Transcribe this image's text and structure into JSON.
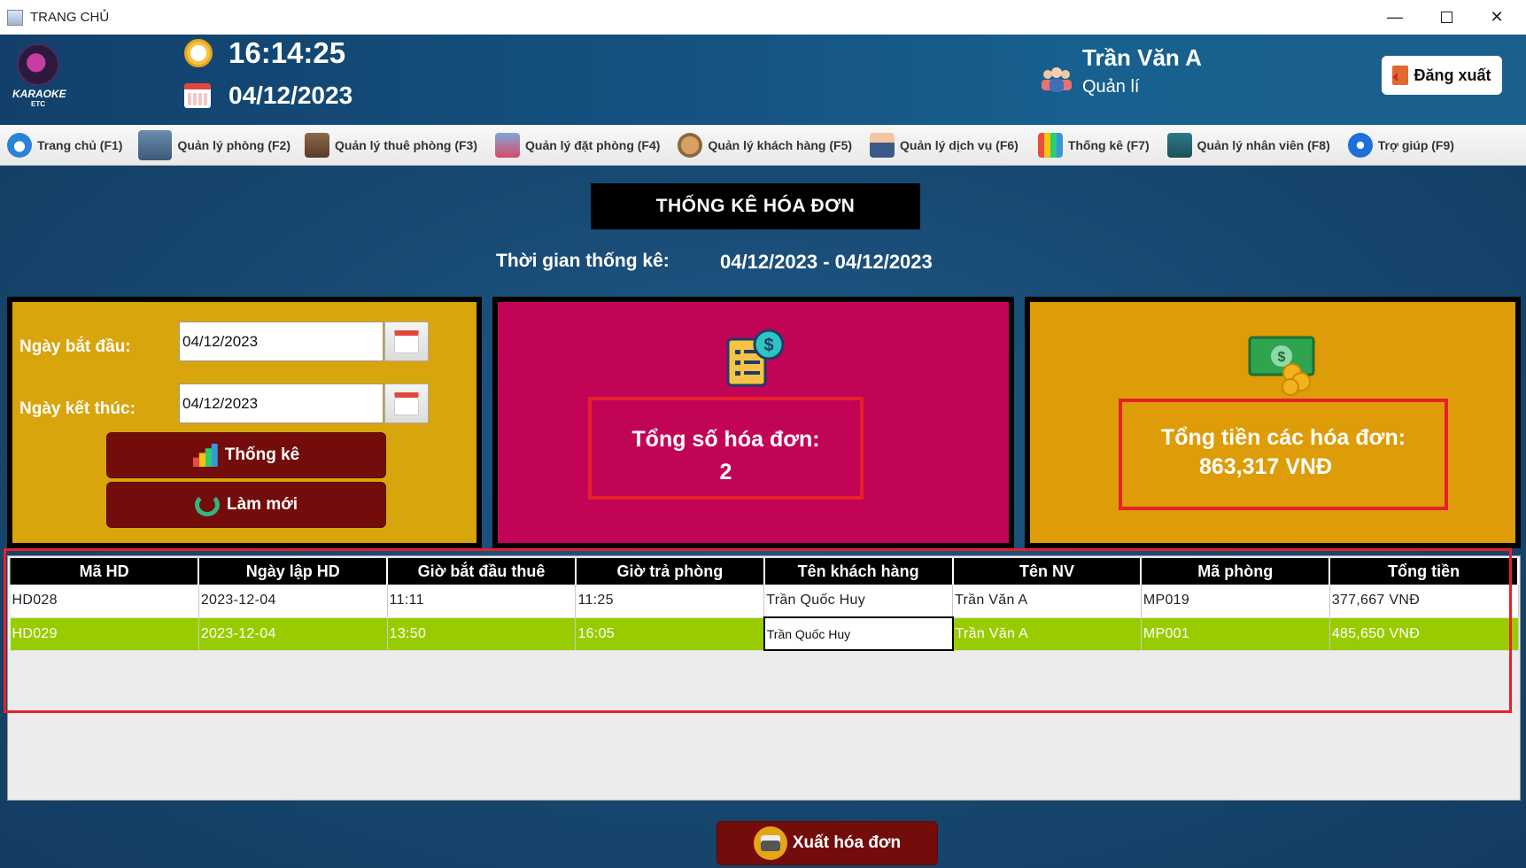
{
  "window": {
    "title": "TRANG CHỦ"
  },
  "header": {
    "logo_text": "KARAOKE",
    "logo_sub": "ETC",
    "time": "16:14:25",
    "date": "04/12/2023",
    "user_name": "Trần Văn A",
    "user_role": "Quản lí",
    "logout_label": "Đăng xuất"
  },
  "menu": [
    {
      "label": "Trang chủ (F1)",
      "icon": "home-icon"
    },
    {
      "label": "Quản lý phòng (F2)",
      "icon": "building-icon"
    },
    {
      "label": "Quản lý thuê phòng (F3)",
      "icon": "hotel-icon"
    },
    {
      "label": "Quản lý đặt phòng (F4)",
      "icon": "phone-booking-icon"
    },
    {
      "label": "Quản lý khách hàng (F5)",
      "icon": "customer-hand-icon"
    },
    {
      "label": "Quản lý dịch vụ (F6)",
      "icon": "staff-service-icon"
    },
    {
      "label": "Thống kê (F7)",
      "icon": "bar-chart-icon"
    },
    {
      "label": "Quản lý nhân viên (F8)",
      "icon": "team-icon"
    },
    {
      "label": "Trợ giúp (F9)",
      "icon": "help-icon"
    }
  ],
  "main": {
    "title": "THỐNG KÊ HÓA ĐƠN",
    "period_label": "Thời gian thống kê:",
    "period_value": "04/12/2023 - 04/12/2023",
    "filter": {
      "start_label": "Ngày bắt đầu:",
      "start_value": "04/12/2023",
      "end_label": "Ngày kết thúc:",
      "end_value": "04/12/2023",
      "stats_button": "Thống kê",
      "refresh_button": "Làm mới"
    },
    "invoice_count": {
      "label": "Tổng số hóa đơn:",
      "value": "2"
    },
    "invoice_total": {
      "label": "Tổng tiền các hóa đơn:",
      "value": "863,317 VNĐ"
    },
    "table": {
      "columns": [
        "Mã HD",
        "Ngày lập HD",
        "Giờ bắt đầu thuê",
        "Giờ trả phòng",
        "Tên khách hàng",
        "Tên NV",
        "Mã phòng",
        "Tổng tiền"
      ],
      "rows": [
        [
          "HD028",
          "2023-12-04",
          "11:11",
          "11:25",
          "Trần Quốc Huy",
          "Trần Văn A",
          "MP019",
          "377,667 VNĐ"
        ],
        [
          "HD029",
          "2023-12-04",
          "13:50",
          "16:05",
          "Trần Quốc Huy",
          "Trần Văn A",
          "MP001",
          "485,650 VNĐ"
        ]
      ]
    },
    "export_button": "Xuất hóa đơn"
  },
  "colors": {
    "header_bg": "#155280",
    "panel_left": "#d8a50c",
    "panel_mid": "#c20456",
    "panel_right": "#de9c08",
    "dark_button": "#740c0c",
    "selected_row": "#99cc00",
    "highlight_border": "#e8202a"
  }
}
